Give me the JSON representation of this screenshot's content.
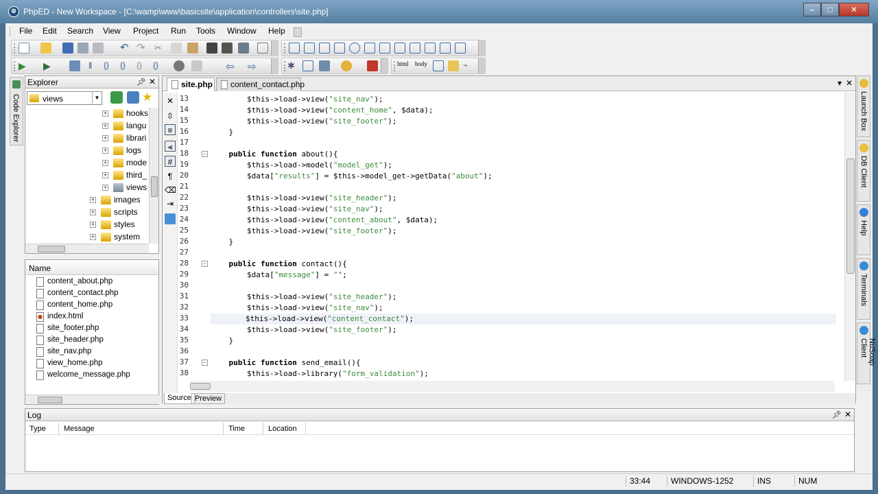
{
  "window": {
    "title": "PhpED - New Workspace - [C:\\wamp\\www\\basicsite\\application\\controllers\\site.php]"
  },
  "menu": [
    "File",
    "Edit",
    "Search",
    "View",
    "Project",
    "Run",
    "Tools",
    "Window",
    "Help"
  ],
  "explorer": {
    "title": "Explorer",
    "current_folder": "views",
    "tree": [
      {
        "label": "hooks",
        "indent": 1
      },
      {
        "label": "langu",
        "indent": 1
      },
      {
        "label": "librari",
        "indent": 1
      },
      {
        "label": "logs",
        "indent": 1
      },
      {
        "label": "mode",
        "indent": 1
      },
      {
        "label": "third_",
        "indent": 1
      },
      {
        "label": "views",
        "indent": 1,
        "selected": true
      },
      {
        "label": "images",
        "indent": 0
      },
      {
        "label": "scripts",
        "indent": 0
      },
      {
        "label": "styles",
        "indent": 0
      },
      {
        "label": "system",
        "indent": 0
      }
    ]
  },
  "left_tab": {
    "label": "Code Explorer"
  },
  "files": {
    "column": "Name",
    "items": [
      {
        "name": "content_about.php",
        "type": "php"
      },
      {
        "name": "content_contact.php",
        "type": "php"
      },
      {
        "name": "content_home.php",
        "type": "php"
      },
      {
        "name": "index.html",
        "type": "html"
      },
      {
        "name": "site_footer.php",
        "type": "php"
      },
      {
        "name": "site_header.php",
        "type": "php"
      },
      {
        "name": "site_nav.php",
        "type": "php"
      },
      {
        "name": "view_home.php",
        "type": "php"
      },
      {
        "name": "welcome_message.php",
        "type": "php"
      }
    ]
  },
  "editor": {
    "tabs": [
      {
        "label": "site.php",
        "active": true
      },
      {
        "label": "content_contact.php",
        "active": false
      }
    ],
    "view_tabs": [
      "Source",
      "Preview"
    ],
    "current_line": 33,
    "lines": [
      {
        "n": "13",
        "fold": false,
        "text": "        $this->load->view(\"site_nav\");"
      },
      {
        "n": "14",
        "fold": false,
        "text": "        $this->load->view(\"content_home\", $data);"
      },
      {
        "n": "15",
        "fold": false,
        "text": "        $this->load->view(\"site_footer\");"
      },
      {
        "n": "16",
        "fold": false,
        "text": "    }"
      },
      {
        "n": "17",
        "fold": false,
        "text": ""
      },
      {
        "n": "18",
        "fold": true,
        "text": "    public function about(){"
      },
      {
        "n": "19",
        "fold": false,
        "text": "        $this->load->model(\"model_get\");"
      },
      {
        "n": "20",
        "fold": false,
        "text": "        $data[\"results\"] = $this->model_get->getData(\"about\");"
      },
      {
        "n": "21",
        "fold": false,
        "text": ""
      },
      {
        "n": "22",
        "fold": false,
        "text": "        $this->load->view(\"site_header\");"
      },
      {
        "n": "23",
        "fold": false,
        "text": "        $this->load->view(\"site_nav\");"
      },
      {
        "n": "24",
        "fold": false,
        "text": "        $this->load->view(\"content_about\", $data);"
      },
      {
        "n": "25",
        "fold": false,
        "text": "        $this->load->view(\"site_footer\");"
      },
      {
        "n": "26",
        "fold": false,
        "text": "    }"
      },
      {
        "n": "27",
        "fold": false,
        "text": ""
      },
      {
        "n": "28",
        "fold": true,
        "text": "    public function contact(){"
      },
      {
        "n": "29",
        "fold": false,
        "text": "        $data[\"message\"] = \"\";"
      },
      {
        "n": "30",
        "fold": false,
        "text": ""
      },
      {
        "n": "31",
        "fold": false,
        "text": "        $this->load->view(\"site_header\");"
      },
      {
        "n": "32",
        "fold": false,
        "text": "        $this->load->view(\"site_nav\");"
      },
      {
        "n": "33",
        "fold": false,
        "text": "        $this->load->view(\"content_contact\");"
      },
      {
        "n": "34",
        "fold": false,
        "text": "        $this->load->view(\"site_footer\");"
      },
      {
        "n": "35",
        "fold": false,
        "text": "    }"
      },
      {
        "n": "36",
        "fold": false,
        "text": ""
      },
      {
        "n": "37",
        "fold": true,
        "text": "    public function send_email(){"
      },
      {
        "n": "38",
        "fold": false,
        "text": "        $this->load->library(\"form_validation\");"
      }
    ]
  },
  "right_tabs": [
    {
      "label": "Launch Box",
      "icon_color": "#e8b93a"
    },
    {
      "label": "DB Client",
      "icon_color": "#e8c23a"
    },
    {
      "label": "Help",
      "icon_color": "#3a7fd6"
    },
    {
      "label": "Terminals",
      "icon_color": "#3a8ad6"
    },
    {
      "label": "NuSoap Client",
      "icon_color": "#3a8ad6"
    }
  ],
  "log": {
    "title": "Log",
    "columns": [
      "Type",
      "Message",
      "Time",
      "Location"
    ]
  },
  "status": {
    "position": "33:44",
    "encoding": "WINDOWS-1252",
    "mode": "INS",
    "numlock": "NUM"
  }
}
